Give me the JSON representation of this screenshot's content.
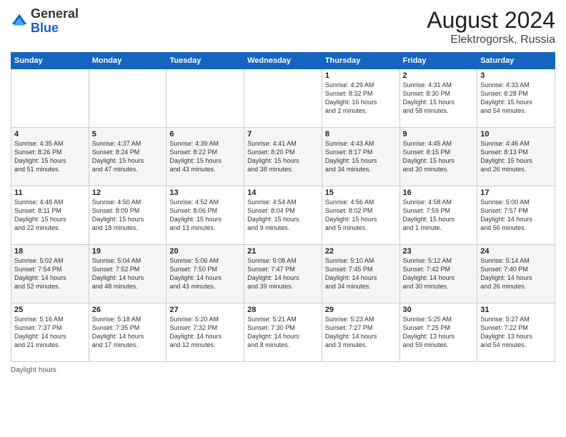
{
  "header": {
    "logo_general": "General",
    "logo_blue": "Blue",
    "month_year": "August 2024",
    "location": "Elektrogorsk, Russia"
  },
  "footer": {
    "daylight_label": "Daylight hours"
  },
  "days_of_week": [
    "Sunday",
    "Monday",
    "Tuesday",
    "Wednesday",
    "Thursday",
    "Friday",
    "Saturday"
  ],
  "weeks": [
    [
      {
        "num": "",
        "info": ""
      },
      {
        "num": "",
        "info": ""
      },
      {
        "num": "",
        "info": ""
      },
      {
        "num": "",
        "info": ""
      },
      {
        "num": "1",
        "info": "Sunrise: 4:29 AM\nSunset: 8:32 PM\nDaylight: 16 hours\nand 2 minutes."
      },
      {
        "num": "2",
        "info": "Sunrise: 4:31 AM\nSunset: 8:30 PM\nDaylight: 15 hours\nand 58 minutes."
      },
      {
        "num": "3",
        "info": "Sunrise: 4:33 AM\nSunset: 8:28 PM\nDaylight: 15 hours\nand 54 minutes."
      }
    ],
    [
      {
        "num": "4",
        "info": "Sunrise: 4:35 AM\nSunset: 8:26 PM\nDaylight: 15 hours\nand 51 minutes."
      },
      {
        "num": "5",
        "info": "Sunrise: 4:37 AM\nSunset: 8:24 PM\nDaylight: 15 hours\nand 47 minutes."
      },
      {
        "num": "6",
        "info": "Sunrise: 4:39 AM\nSunset: 8:22 PM\nDaylight: 15 hours\nand 43 minutes."
      },
      {
        "num": "7",
        "info": "Sunrise: 4:41 AM\nSunset: 8:20 PM\nDaylight: 15 hours\nand 38 minutes."
      },
      {
        "num": "8",
        "info": "Sunrise: 4:43 AM\nSunset: 8:17 PM\nDaylight: 15 hours\nand 34 minutes."
      },
      {
        "num": "9",
        "info": "Sunrise: 4:45 AM\nSunset: 8:15 PM\nDaylight: 15 hours\nand 30 minutes."
      },
      {
        "num": "10",
        "info": "Sunrise: 4:46 AM\nSunset: 8:13 PM\nDaylight: 15 hours\nand 26 minutes."
      }
    ],
    [
      {
        "num": "11",
        "info": "Sunrise: 4:48 AM\nSunset: 8:11 PM\nDaylight: 15 hours\nand 22 minutes."
      },
      {
        "num": "12",
        "info": "Sunrise: 4:50 AM\nSunset: 8:09 PM\nDaylight: 15 hours\nand 18 minutes."
      },
      {
        "num": "13",
        "info": "Sunrise: 4:52 AM\nSunset: 8:06 PM\nDaylight: 15 hours\nand 13 minutes."
      },
      {
        "num": "14",
        "info": "Sunrise: 4:54 AM\nSunset: 8:04 PM\nDaylight: 15 hours\nand 9 minutes."
      },
      {
        "num": "15",
        "info": "Sunrise: 4:56 AM\nSunset: 8:02 PM\nDaylight: 15 hours\nand 5 minutes."
      },
      {
        "num": "16",
        "info": "Sunrise: 4:58 AM\nSunset: 7:59 PM\nDaylight: 15 hours\nand 1 minute."
      },
      {
        "num": "17",
        "info": "Sunrise: 5:00 AM\nSunset: 7:57 PM\nDaylight: 14 hours\nand 56 minutes."
      }
    ],
    [
      {
        "num": "18",
        "info": "Sunrise: 5:02 AM\nSunset: 7:54 PM\nDaylight: 14 hours\nand 52 minutes."
      },
      {
        "num": "19",
        "info": "Sunrise: 5:04 AM\nSunset: 7:52 PM\nDaylight: 14 hours\nand 48 minutes."
      },
      {
        "num": "20",
        "info": "Sunrise: 5:06 AM\nSunset: 7:50 PM\nDaylight: 14 hours\nand 43 minutes."
      },
      {
        "num": "21",
        "info": "Sunrise: 5:08 AM\nSunset: 7:47 PM\nDaylight: 14 hours\nand 39 minutes."
      },
      {
        "num": "22",
        "info": "Sunrise: 5:10 AM\nSunset: 7:45 PM\nDaylight: 14 hours\nand 34 minutes."
      },
      {
        "num": "23",
        "info": "Sunrise: 5:12 AM\nSunset: 7:42 PM\nDaylight: 14 hours\nand 30 minutes."
      },
      {
        "num": "24",
        "info": "Sunrise: 5:14 AM\nSunset: 7:40 PM\nDaylight: 14 hours\nand 26 minutes."
      }
    ],
    [
      {
        "num": "25",
        "info": "Sunrise: 5:16 AM\nSunset: 7:37 PM\nDaylight: 14 hours\nand 21 minutes."
      },
      {
        "num": "26",
        "info": "Sunrise: 5:18 AM\nSunset: 7:35 PM\nDaylight: 14 hours\nand 17 minutes."
      },
      {
        "num": "27",
        "info": "Sunrise: 5:20 AM\nSunset: 7:32 PM\nDaylight: 14 hours\nand 12 minutes."
      },
      {
        "num": "28",
        "info": "Sunrise: 5:21 AM\nSunset: 7:30 PM\nDaylight: 14 hours\nand 8 minutes."
      },
      {
        "num": "29",
        "info": "Sunrise: 5:23 AM\nSunset: 7:27 PM\nDaylight: 14 hours\nand 3 minutes."
      },
      {
        "num": "30",
        "info": "Sunrise: 5:25 AM\nSunset: 7:25 PM\nDaylight: 13 hours\nand 59 minutes."
      },
      {
        "num": "31",
        "info": "Sunrise: 5:27 AM\nSunset: 7:22 PM\nDaylight: 13 hours\nand 54 minutes."
      }
    ]
  ]
}
